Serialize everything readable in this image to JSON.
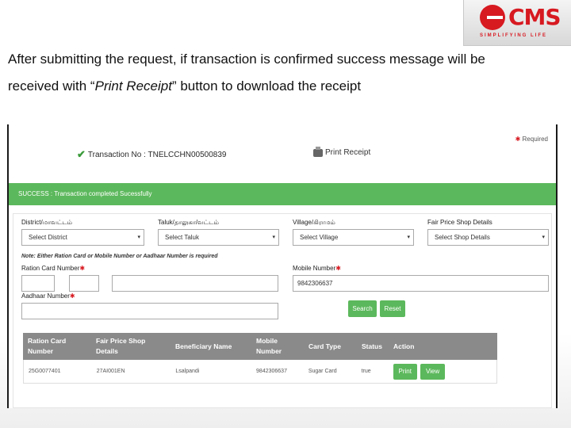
{
  "slide": {
    "caption_part1": "After submitting the request, if transaction is confirmed success message will be received with “",
    "caption_italic": "Print Receipt",
    "caption_part2": "” button to download the receipt"
  },
  "logo": {
    "text": "CMS",
    "tagline": "SIMPLIFYING LIFE"
  },
  "form": {
    "required_label": "Required",
    "transaction_label": "Transaction No : TNELCCHN00500839",
    "print_receipt_label": "Print Receipt",
    "success_message": "SUCCESS : Transaction completed Sucessfully",
    "fields": {
      "district_label": "District/மாவட்டம்",
      "district_value": "Select District",
      "taluk_label": "Taluk/தாலுகா/வட்டம்",
      "taluk_value": "Select Taluk",
      "village_label": "Village/கிராமம்",
      "village_value": "Select Village",
      "shop_label": "Fair Price Shop Details",
      "shop_value": "Select Shop Details",
      "note": "Note: Either Ration Card or Mobile Number or Aadhaar Number is required",
      "ration_label": "Ration Card Number",
      "mobile_label": "Mobile Number",
      "mobile_value": "9842306637",
      "aadhaar_label": "Aadhaar Number"
    },
    "search_label": "Search",
    "reset_label": "Reset"
  },
  "table": {
    "headers": [
      "Ration Card Number",
      "Fair Price Shop Details",
      "Beneficiary Name",
      "Mobile Number",
      "Card Type",
      "Status",
      "Action"
    ],
    "rows": [
      {
        "ration_card": "25G0077401",
        "shop": "27AI001EN",
        "name": "Lsalpandi",
        "mobile": "9842306637",
        "card_type": "Sugar Card",
        "status": "true",
        "print_label": "Print",
        "view_label": "View"
      }
    ]
  }
}
